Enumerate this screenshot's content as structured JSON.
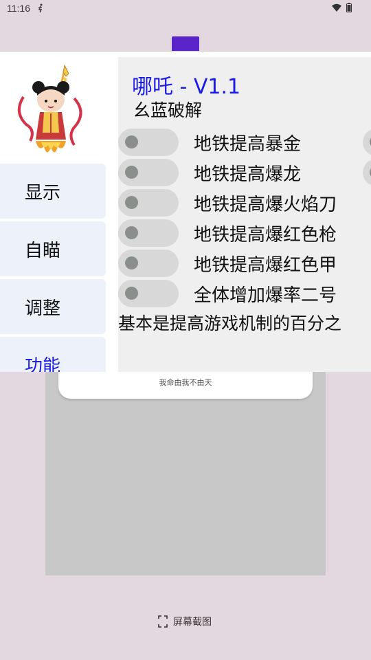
{
  "status_bar": {
    "time": "11:16"
  },
  "background_app": {
    "card_text": "我命由我不由天",
    "screenshot_label": "屏幕截图"
  },
  "menu": {
    "nav": [
      {
        "label": "显示",
        "active": false
      },
      {
        "label": "自瞄",
        "active": false
      },
      {
        "label": "调整",
        "active": false
      },
      {
        "label": "功能",
        "active": true
      }
    ],
    "title": "哪吒 - V1.1",
    "subtitle": "幺蓝破解",
    "toggles": [
      {
        "label": "地铁提高暴金",
        "on": false
      },
      {
        "label": "地铁提高爆龙",
        "on": false
      },
      {
        "label": "地铁提高爆火焰刀",
        "on": false
      },
      {
        "label": "地铁提高爆红色枪",
        "on": false
      },
      {
        "label": "地铁提高爆红色甲",
        "on": false
      },
      {
        "label": "全体增加爆率二号",
        "on": false
      }
    ],
    "footer_note": "基本是提高游戏机制的百分之"
  },
  "colors": {
    "accent": "#1a1ae6",
    "nav_bg": "#edf2fa",
    "panel_bg": "#efefef",
    "toggle_track": "#d8d8d8",
    "toggle_thumb": "#8b8f8b",
    "backdrop": "#e4d8e0"
  }
}
